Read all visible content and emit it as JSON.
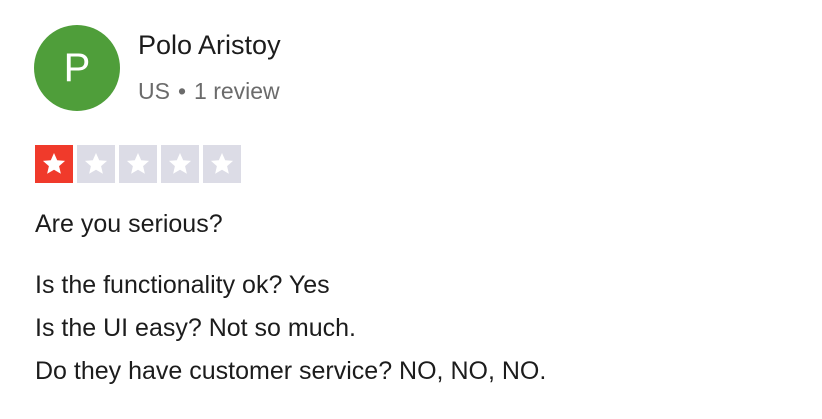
{
  "reviewer": {
    "initial": "P",
    "name": "Polo Aristoy",
    "country": "US",
    "separator": "•",
    "review_count": "1 review",
    "avatar_color": "#4f9e3a"
  },
  "rating": {
    "value": 1,
    "max": 5,
    "filled_color": "#f03a2b",
    "empty_color": "#dcdce6",
    "star_color": "#ffffff"
  },
  "review": {
    "title": "Are you serious?",
    "body_lines": [
      "Is the functionality ok? Yes",
      "Is the UI easy? Not so much.",
      "Do they have customer service? NO, NO, NO."
    ]
  }
}
